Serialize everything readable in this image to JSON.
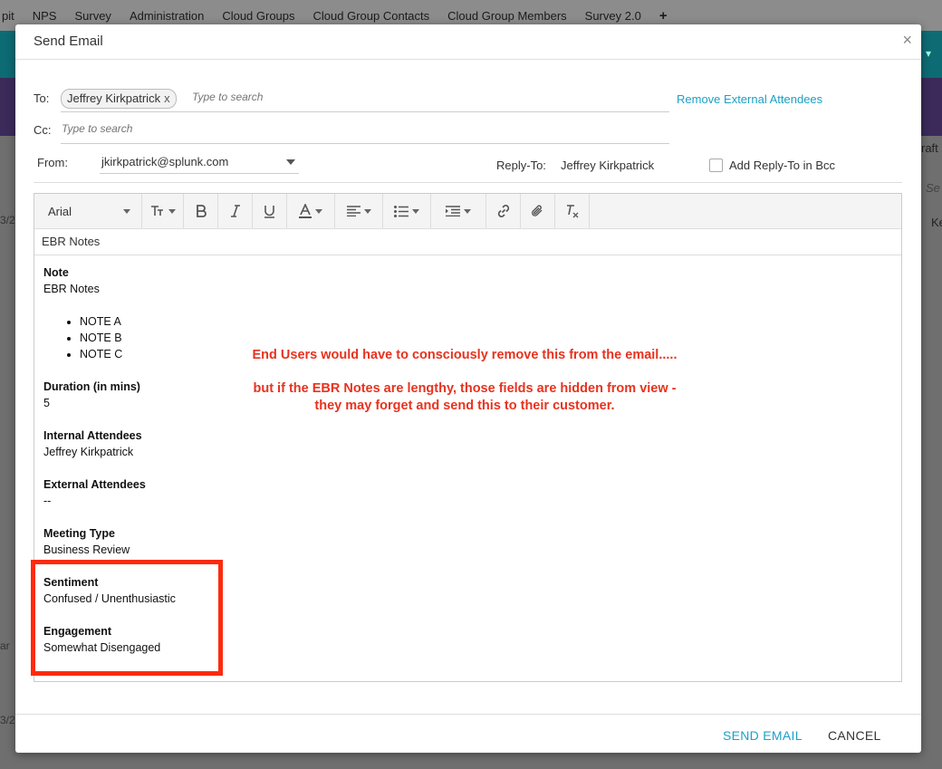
{
  "background": {
    "nav_items": [
      "pit",
      "NPS",
      "Survey",
      "Administration",
      "Cloud Groups",
      "Cloud Group Contacts",
      "Cloud Group Members",
      "Survey 2.0"
    ],
    "nav_add": "+",
    "right_tab_fragment": "raft",
    "right_search_fragment": "Se",
    "right_name_fragment": "Ke",
    "left_fragment_1": "3/2",
    "left_fragment_2": "ar",
    "left_fragment_3": "3/2"
  },
  "modal": {
    "title": "Send Email",
    "close": "×",
    "to_label": "To:",
    "to_chip": "Jeffrey Kirkpatrick",
    "chip_remove": "x",
    "to_placeholder": "Type to search",
    "cc_label": "Cc:",
    "cc_placeholder": "Type to search",
    "remove_external": "Remove External Attendees",
    "from_label": "From:",
    "from_value": "jkirkpatrick@splunk.com",
    "reply_to_label": "Reply-To:",
    "reply_to_value": "Jeffrey Kirkpatrick",
    "add_reply_bcc": "Add Reply-To in Bcc"
  },
  "editor": {
    "font": "Arial",
    "subject": "EBR Notes",
    "body": {
      "note_label": "Note",
      "note_value": "EBR Notes",
      "bullets": [
        "NOTE A",
        "NOTE B",
        "NOTE C"
      ],
      "duration_label": "Duration (in mins)",
      "duration_value": "5",
      "internal_label": "Internal Attendees",
      "internal_value": "Jeffrey Kirkpatrick",
      "external_label": "External Attendees",
      "external_value": "--",
      "meeting_label": "Meeting Type",
      "meeting_value": "Business Review",
      "sentiment_label": "Sentiment",
      "sentiment_value": "Confused / Unenthusiastic",
      "engagement_label": "Engagement",
      "engagement_value": "Somewhat Disengaged"
    }
  },
  "annotation": {
    "line1": "End Users would have to consciously remove this from the email.....",
    "line2": "but if the EBR Notes are lengthy, those fields are hidden from view -",
    "line3": "they may forget and send this to their customer.",
    "color": "#e8321e"
  },
  "footer": {
    "send": "SEND EMAIL",
    "cancel": "CANCEL"
  },
  "colors": {
    "accent": "#1ba1c4",
    "highlight_box": "#ff2a0d"
  }
}
